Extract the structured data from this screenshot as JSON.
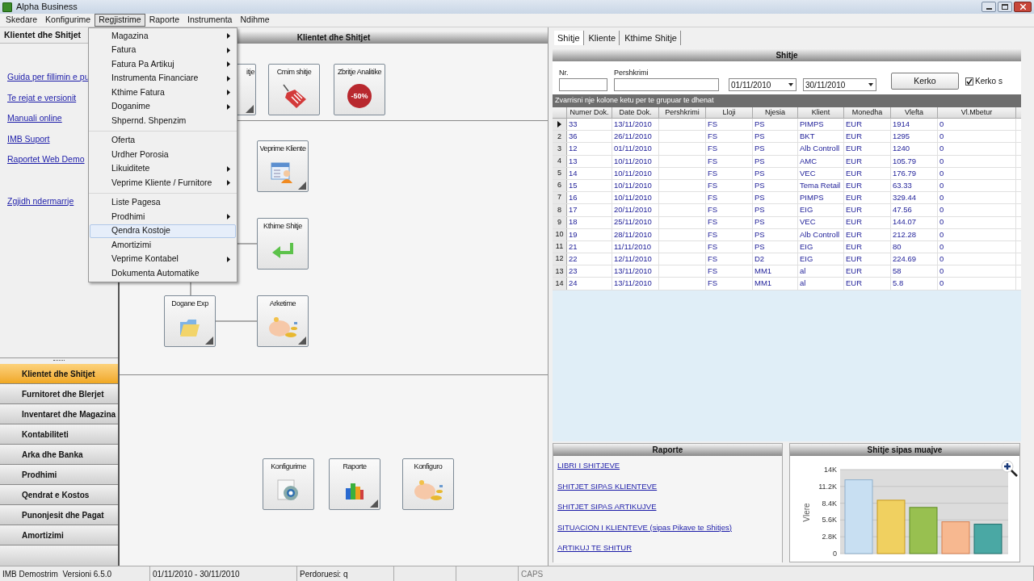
{
  "window": {
    "title": "Alpha Business"
  },
  "menu_bar": [
    {
      "label": "Skedare",
      "selected": false
    },
    {
      "label": "Konfigurime",
      "selected": false
    },
    {
      "label": "Regjistrime",
      "selected": true
    },
    {
      "label": "Raporte",
      "selected": false
    },
    {
      "label": "Instrumenta",
      "selected": false
    },
    {
      "label": "Ndihme",
      "selected": false
    }
  ],
  "open_menu": {
    "groups": [
      [
        {
          "label": "Magazina",
          "submenu": true,
          "selected": false
        },
        {
          "label": "Fatura",
          "submenu": true,
          "selected": false
        },
        {
          "label": "Fatura Pa Artikuj",
          "submenu": true,
          "selected": false
        },
        {
          "label": "Instrumenta Financiare",
          "submenu": true,
          "selected": false
        },
        {
          "label": "Kthime Fatura",
          "submenu": true,
          "selected": false
        },
        {
          "label": "Doganime",
          "submenu": true,
          "selected": false
        },
        {
          "label": "Shpernd. Shpenzim",
          "submenu": false,
          "selected": false
        }
      ],
      [
        {
          "label": "Oferta",
          "submenu": false,
          "selected": false
        },
        {
          "label": "Urdher Porosia",
          "submenu": false,
          "selected": false
        },
        {
          "label": "Likuiditete",
          "submenu": true,
          "selected": false
        },
        {
          "label": "Veprime Kliente / Furnitore",
          "submenu": true,
          "selected": false
        }
      ],
      [
        {
          "label": "Liste Pagesa",
          "submenu": false,
          "selected": false
        },
        {
          "label": "Prodhimi",
          "submenu": true,
          "selected": false
        },
        {
          "label": "Qendra Kostoje",
          "submenu": false,
          "selected": true
        },
        {
          "label": "Amortizimi",
          "submenu": false,
          "selected": false
        },
        {
          "label": "Veprime Kontabel",
          "submenu": true,
          "selected": false
        },
        {
          "label": "Dokumenta Automatike",
          "submenu": false,
          "selected": false
        }
      ]
    ]
  },
  "sidebar": {
    "title": "Klientet dhe Shitjet",
    "links": [
      "Guida per fillimin e pu",
      "Te rejat e versionit",
      "Manuali online",
      "IMB Suport",
      "Raportet Web Demo",
      "Zgjidh ndermarrje"
    ],
    "nav": [
      {
        "label": "Klientet dhe Shitjet",
        "selected": true
      },
      {
        "label": "Furnitoret dhe Blerjet",
        "selected": false
      },
      {
        "label": "Inventaret dhe Magazina",
        "selected": false
      },
      {
        "label": "Kontabiliteti",
        "selected": false
      },
      {
        "label": "Arka dhe Banka",
        "selected": false
      },
      {
        "label": "Prodhimi",
        "selected": false
      },
      {
        "label": "Qendrat e Kostos",
        "selected": false
      },
      {
        "label": "Punonjesit dhe Pagat",
        "selected": false
      },
      {
        "label": "Amortizimi",
        "selected": false
      }
    ]
  },
  "workflow": {
    "title": "Klientet dhe Shitjet",
    "nodes": [
      {
        "label": "itje",
        "has_menu": true
      },
      {
        "label": "Cmim shitje",
        "has_menu": false
      },
      {
        "label": "Zbritje Analitike",
        "badge": "-50%",
        "has_menu": false
      },
      {
        "label": "Veprime Kliente",
        "has_menu": true
      },
      {
        "label": "Kthime Shitje",
        "has_menu": false
      },
      {
        "label": "Dogane Exp",
        "has_menu": true
      },
      {
        "label": "Arketime",
        "has_menu": true
      },
      {
        "label": "Konfigurime",
        "has_menu": false
      },
      {
        "label": "Raporte",
        "has_menu": true
      },
      {
        "label": "Konfiguro",
        "has_menu": false
      }
    ]
  },
  "tabs": [
    {
      "label": "Shitje",
      "selected": true
    },
    {
      "label": "Kliente",
      "selected": false
    },
    {
      "label": "Kthime Shitje",
      "selected": false
    }
  ],
  "sales": {
    "title": "Shitje",
    "filters": {
      "nr_label": "Nr.",
      "description_label": "Pershkrimi",
      "date_from": "01/11/2010",
      "date_to": "30/11/2010",
      "search_button": "Kerko",
      "option": {
        "label": "Kerko s",
        "checked": true
      }
    },
    "group_hint": "Zvarrisni nje kolone ketu per te grupuar te dhenat",
    "columns": [
      "Numer Dok.",
      "Date Dok.",
      "Pershkrimi",
      "Lloji",
      "Njesia",
      "Klient",
      "Monedha",
      "Vlefta",
      "Vl.Mbetur"
    ],
    "rows": [
      {
        "index": "",
        "current": true,
        "cells": [
          "33",
          "13/11/2010",
          "",
          "FS",
          "PS",
          "PIMPS",
          "EUR",
          "1914",
          "0"
        ]
      },
      {
        "index": "2",
        "current": false,
        "cells": [
          "36",
          "26/11/2010",
          "",
          "FS",
          "PS",
          "BKT",
          "EUR",
          "1295",
          "0"
        ]
      },
      {
        "index": "3",
        "current": false,
        "cells": [
          "12",
          "01/11/2010",
          "",
          "FS",
          "PS",
          "Alb Controll",
          "EUR",
          "1240",
          "0"
        ]
      },
      {
        "index": "4",
        "current": false,
        "cells": [
          "13",
          "10/11/2010",
          "",
          "FS",
          "PS",
          "AMC",
          "EUR",
          "105.79",
          "0"
        ]
      },
      {
        "index": "5",
        "current": false,
        "cells": [
          "14",
          "10/11/2010",
          "",
          "FS",
          "PS",
          "VEC",
          "EUR",
          "176.79",
          "0"
        ]
      },
      {
        "index": "6",
        "current": false,
        "cells": [
          "15",
          "10/11/2010",
          "",
          "FS",
          "PS",
          "Tema Retail",
          "EUR",
          "63.33",
          "0"
        ]
      },
      {
        "index": "7",
        "current": false,
        "cells": [
          "16",
          "10/11/2010",
          "",
          "FS",
          "PS",
          "PIMPS",
          "EUR",
          "329.44",
          "0"
        ]
      },
      {
        "index": "8",
        "current": false,
        "cells": [
          "17",
          "20/11/2010",
          "",
          "FS",
          "PS",
          "EIG",
          "EUR",
          "47.56",
          "0"
        ]
      },
      {
        "index": "9",
        "current": false,
        "cells": [
          "18",
          "25/11/2010",
          "",
          "FS",
          "PS",
          "VEC",
          "EUR",
          "144.07",
          "0"
        ]
      },
      {
        "index": "10",
        "current": false,
        "cells": [
          "19",
          "28/11/2010",
          "",
          "FS",
          "PS",
          "Alb Controll",
          "EUR",
          "212.28",
          "0"
        ]
      },
      {
        "index": "11",
        "current": false,
        "cells": [
          "21",
          "11/11/2010",
          "",
          "FS",
          "PS",
          "EIG",
          "EUR",
          "80",
          "0"
        ]
      },
      {
        "index": "12",
        "current": false,
        "cells": [
          "22",
          "12/11/2010",
          "",
          "FS",
          "D2",
          "EIG",
          "EUR",
          "224.69",
          "0"
        ]
      },
      {
        "index": "13",
        "current": false,
        "cells": [
          "23",
          "13/11/2010",
          "",
          "FS",
          "MM1",
          "al",
          "EUR",
          "58",
          "0"
        ]
      },
      {
        "index": "14",
        "current": false,
        "cells": [
          "24",
          "13/11/2010",
          "",
          "FS",
          "MM1",
          "al",
          "EUR",
          "5.8",
          "0"
        ]
      }
    ]
  },
  "reports": {
    "title": "Raporte",
    "links": [
      "LIBRI I SHITJEVE",
      "SHITJET SIPAS KLIENTEVE",
      "SHITJET SIPAS ARTIKUJVE",
      "SITUACION I KLIENTEVE (sipas Pikave te Shitjes)",
      "ARTIKUJ TE SHITUR"
    ]
  },
  "monthly_chart": {
    "title": "Shitje sipas muajve",
    "chart_data": {
      "type": "bar",
      "ylabel": "Vlere",
      "values": [
        12300,
        8900,
        7700,
        5300,
        4900
      ],
      "grid": true,
      "ylim": [
        0,
        14000
      ],
      "yticks": [
        {
          "value": 0,
          "label": "0"
        },
        {
          "value": 2800,
          "label": "2.8K"
        },
        {
          "value": 5600,
          "label": "5.6K"
        },
        {
          "value": 8400,
          "label": "8.4K"
        },
        {
          "value": 11200,
          "label": "11.2K"
        },
        {
          "value": 14000,
          "label": "14K"
        }
      ]
    }
  },
  "status_bar": [
    "IMB Demostrim  Versioni 6.5.0",
    "01/11/2010 - 30/11/2010",
    "Perdoruesi: q",
    "CAPS"
  ]
}
